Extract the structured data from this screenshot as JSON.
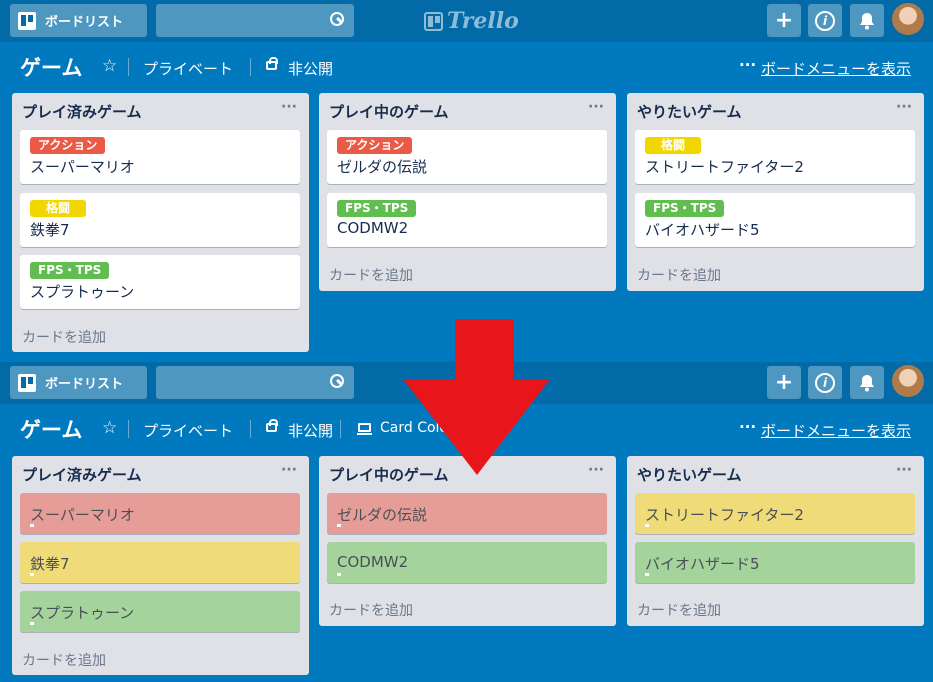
{
  "header": {
    "boards_button": "ボードリスト",
    "logo_text": "Trello",
    "add_button": "+",
    "info_button": "i"
  },
  "board": {
    "title": "ゲーム",
    "star": "☆",
    "visibility_team": "プライベート",
    "visibility": "非公開",
    "powerup": "Card Colors Merge",
    "menu_dots": "···",
    "menu_link": "ボードメニューを表示"
  },
  "lists_before": [
    {
      "title": "プレイ済みゲーム",
      "cards": [
        {
          "label": "アクション",
          "label_color": "#eb5a46",
          "text": "スーパーマリオ"
        },
        {
          "label": "格闘",
          "label_color": "#f2d600",
          "text": "鉄拳7"
        },
        {
          "label": "FPS・TPS",
          "label_color": "#61bd4f",
          "text": "スプラトゥーン"
        }
      ],
      "add_card": "カードを追加"
    },
    {
      "title": "プレイ中のゲーム",
      "cards": [
        {
          "label": "アクション",
          "label_color": "#eb5a46",
          "text": "ゼルダの伝説"
        },
        {
          "label": "FPS・TPS",
          "label_color": "#61bd4f",
          "text": "CODMW2"
        }
      ],
      "add_card": "カードを追加"
    },
    {
      "title": "やりたいゲーム",
      "cards": [
        {
          "label": "格闘",
          "label_color": "#f2d600",
          "text": "ストリートファイター2"
        },
        {
          "label": "FPS・TPS",
          "label_color": "#61bd4f",
          "text": "バイオハザード5"
        }
      ],
      "add_card": "カードを追加"
    }
  ],
  "lists_after": [
    {
      "title": "プレイ済みゲーム",
      "cards": [
        {
          "text": "スーパーマリオ",
          "color": "#e79d97"
        },
        {
          "text": "鉄拳7",
          "color": "#efdc78"
        },
        {
          "text": "スプラトゥーン",
          "color": "#a4d49b"
        }
      ],
      "add_card": "カードを追加"
    },
    {
      "title": "プレイ中のゲーム",
      "cards": [
        {
          "text": "ゼルダの伝説",
          "color": "#e79d97"
        },
        {
          "text": "CODMW2",
          "color": "#a4d49b"
        }
      ],
      "add_card": "カードを追加"
    },
    {
      "title": "やりたいゲーム",
      "cards": [
        {
          "text": "ストリートファイター2",
          "color": "#efdc78"
        },
        {
          "text": "バイオハザード5",
          "color": "#a4d49b"
        }
      ],
      "add_card": "カードを追加"
    }
  ],
  "colors": {
    "board_background": "#0079bf",
    "header_background": "#026aa7",
    "list_background": "#dfe1e6",
    "arrow": "#e8161b"
  }
}
